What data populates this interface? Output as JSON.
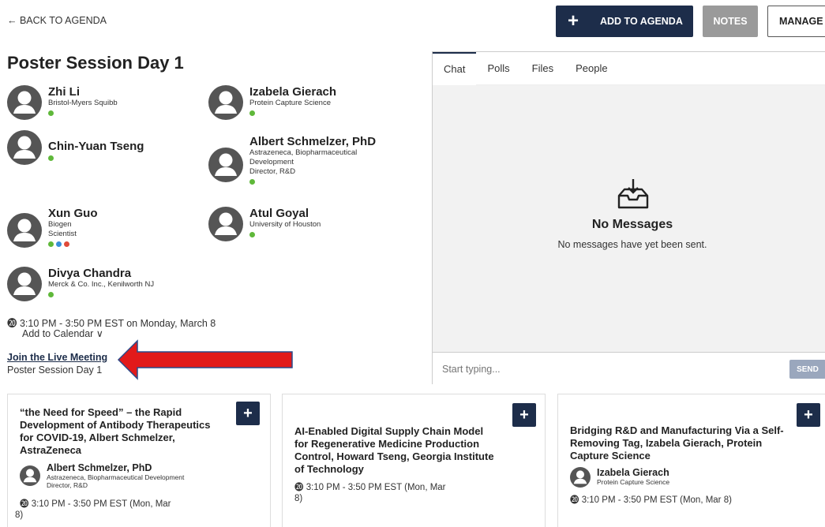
{
  "topbar": {
    "back_label": "← BACK TO AGENDA",
    "add_plus": "+",
    "add_label": "ADD TO AGENDA",
    "notes_label": "NOTES",
    "manage_label": "MANAGE"
  },
  "session": {
    "title": "Poster Session Day 1",
    "time": "⓴ 3:10 PM - 3:50 PM EST on Monday, March 8",
    "calendar_label": "Add to Calendar ∨",
    "join_label": "Join the Live Meeting",
    "join_sub": "Poster Session Day 1"
  },
  "speakers": [
    {
      "name": "Zhi Li",
      "org": "Bristol-Myers Squibb",
      "org2": "",
      "org3": ""
    },
    {
      "name": "Izabela Gierach",
      "org": "Protein Capture Science",
      "org2": "",
      "org3": ""
    },
    {
      "name": "Chin-Yuan Tseng",
      "org": "",
      "org2": "",
      "org3": ""
    },
    {
      "name": "Albert Schmelzer, PhD",
      "org": "Astrazeneca, Biopharmaceutical",
      "org2": "Development",
      "org3": "Director, R&D"
    },
    {
      "name": "Xun Guo",
      "org": "Biogen",
      "org2": "Scientist",
      "org3": ""
    },
    {
      "name": "Atul Goyal",
      "org": "University of Houston",
      "org2": "",
      "org3": ""
    },
    {
      "name": "Divya Chandra",
      "org": "Merck & Co. Inc., Kenilworth NJ",
      "org2": "",
      "org3": ""
    }
  ],
  "colors": {
    "primary": "#1d2d4a",
    "status_green": "#5fb83a",
    "status_blue": "#3a8fd9",
    "status_red": "#e04a3a",
    "arrow_red": "#e21a1a",
    "arrow_border": "#2a4a8a"
  },
  "chat": {
    "tabs": [
      "Chat",
      "Polls",
      "Files",
      "People"
    ],
    "empty_title": "No Messages",
    "empty_sub": "No messages have yet been sent.",
    "input_placeholder": "Start typing...",
    "send_label": "SEND"
  },
  "cards": [
    {
      "title_lines": [
        "“the Need for Speed” – the Rapid",
        "Development of Antibody Therapeutics",
        "for COVID-19, Albert Schmelzer,",
        "AstraZeneca"
      ],
      "speaker_name": "Albert Schmelzer, PhD",
      "speaker_org": "Astrazeneca, Biopharmaceutical Development",
      "speaker_org2": "Director, R&D",
      "time_lines": [
        "⓴ 3:10 PM - 3:50 PM EST (Mon, Mar",
        "8)"
      ]
    },
    {
      "title_lines": [
        "AI-Enabled Digital Supply Chain Model",
        "for Regenerative Medicine Production",
        "Control, Howard Tseng, Georgia Institute",
        "of Technology"
      ],
      "time_lines": [
        "⓴ 3:10 PM - 3:50 PM EST (Mon, Mar",
        "8)"
      ]
    },
    {
      "title_lines": [
        "Bridging R&D and Manufacturing Via a Self-",
        "Removing Tag, Izabela Gierach, Protein",
        "Capture Science"
      ],
      "speaker_name": "Izabela Gierach",
      "speaker_org": "Protein Capture Science",
      "time_lines": [
        "⓴ 3:10 PM - 3:50 PM EST (Mon, Mar 8)"
      ]
    }
  ],
  "icons": {
    "avatar": "user-avatar-icon",
    "inbox": "inbox-download-icon",
    "clock": "clock-icon",
    "plus": "plus-icon"
  },
  "card_plus": "+"
}
